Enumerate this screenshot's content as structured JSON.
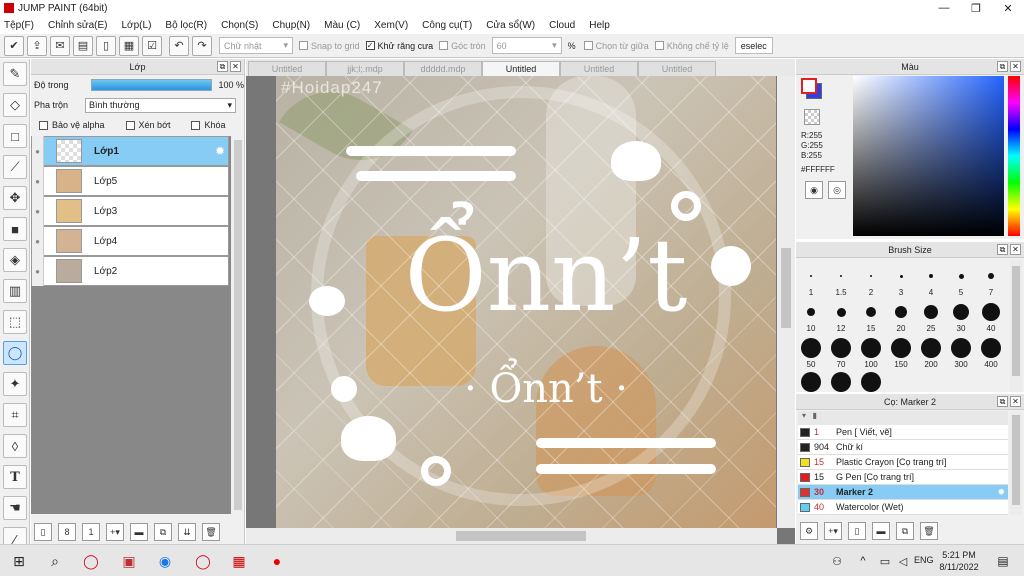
{
  "window": {
    "title": "JUMP PAINT (64bit)",
    "minimize": "—",
    "maximize": "❐",
    "close": "✕"
  },
  "menu": [
    "Tệp(F)",
    "Chỉnh sửa(E)",
    "Lớp(L)",
    "Bộ lọc(R)",
    "Chọn(S)",
    "Chụp(N)",
    "Màu (C)",
    "Xem(V)",
    "Công cụ(T)",
    "Cửa sổ(W)",
    "Cloud",
    "Help"
  ],
  "toolbar": {
    "shape_select": "Chữ nhật",
    "snap_to_grid": "Snap to grid",
    "antialias": "Khử răng cưa",
    "round_corner": "Góc tròn",
    "round_value": "60",
    "percent": "%",
    "select_center": "Chọn từ giữa",
    "no_ratio": "Không chế tỷ lệ",
    "deselect": "eselec"
  },
  "layer_panel": {
    "title": "Lớp",
    "opacity_label": "Độ trong",
    "opacity_value": "100 %",
    "blend_label": "Pha trộn",
    "blend_value": "Bình thường",
    "protect_alpha": "Bảo vệ alpha",
    "clip": "Xén bớt",
    "lock": "Khóa",
    "layers": [
      {
        "name": "Lớp1",
        "selected": true
      },
      {
        "name": "Lớp5",
        "selected": false
      },
      {
        "name": "Lớp3",
        "selected": false
      },
      {
        "name": "Lớp4",
        "selected": false
      },
      {
        "name": "Lớp2",
        "selected": false
      }
    ]
  },
  "tabs": [
    "Untitled",
    "jjk;l;.mdp",
    "ddddd.mdp",
    "Untitled",
    "Untitled",
    "Untitled"
  ],
  "canvas": {
    "watermark": "#Hoidap247",
    "big_text": "Ổnn’t",
    "small_text": "· Ổnn’t ·"
  },
  "color_panel": {
    "title": "Màu",
    "r": "R:255",
    "g": "G:255",
    "b": "B:255",
    "hex": "#FFFFFF"
  },
  "brush_panel": {
    "title": "Brush Size",
    "sizes": [
      "1",
      "1.5",
      "2",
      "3",
      "4",
      "5",
      "7",
      "10",
      "12",
      "15",
      "20",
      "25",
      "30",
      "40",
      "50",
      "70",
      "100",
      "150",
      "200",
      "300",
      "400"
    ]
  },
  "tool_panel": {
    "title": "Cọ: Marker 2",
    "items": [
      {
        "size": "1",
        "name": "Pen [ Viết, vẽ]",
        "color": "#222222"
      },
      {
        "size": "904",
        "name": "Chữ kí",
        "color": "#222222"
      },
      {
        "size": "15",
        "name": "Plastic Crayon [Cọ trang trí]",
        "color": "#f0e020"
      },
      {
        "size": "15",
        "name": "G Pen [Cọ trang trí]",
        "color": "#e02020"
      },
      {
        "size": "30",
        "name": "Marker 2",
        "color": "#e03030"
      },
      {
        "size": "40",
        "name": "Watercolor (Wet)",
        "color": "#60d0f0"
      }
    ]
  },
  "taskbar": {
    "lang": "ENG",
    "time": "5:21 PM",
    "date": "8/11/2022"
  }
}
